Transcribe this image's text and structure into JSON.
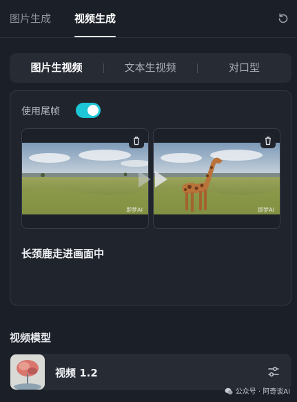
{
  "tabs": [
    {
      "label": "图片生成",
      "active": false
    },
    {
      "label": "视频生成",
      "active": true
    }
  ],
  "mode_tabs": [
    {
      "label": "图片生视频",
      "active": true
    },
    {
      "label": "文本生视频",
      "active": false
    },
    {
      "label": "对口型",
      "active": false
    }
  ],
  "card": {
    "tail_frame_label": "使用尾帧",
    "tail_frame_enabled": true,
    "frames": [
      {
        "scene": "savanna-landscape",
        "watermark": "即梦AI"
      },
      {
        "scene": "savanna-giraffe",
        "watermark": "即梦AI"
      }
    ],
    "prompt": "长颈鹿走进画面中"
  },
  "model_section": {
    "title": "视频模型",
    "model_name": "视频 1.2"
  },
  "watermark": {
    "text": "公众号 · 阿奇谈AI"
  },
  "colors": {
    "background": "#1b1f27",
    "panel": "#262b34",
    "toggle_on": "#1cc6d6"
  },
  "icons": [
    "refresh-icon",
    "trash-icon",
    "play-icon",
    "settings-sliders-icon",
    "wechat-icon"
  ]
}
